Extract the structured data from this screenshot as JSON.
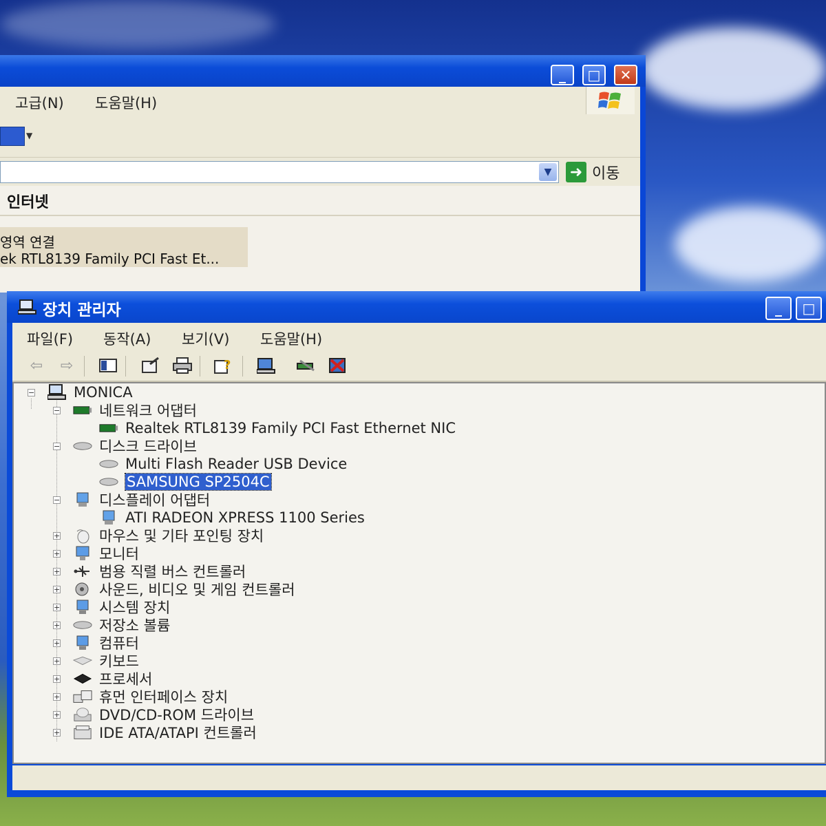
{
  "background_window": {
    "menu": [
      "고급(N)",
      "도움말(H)"
    ],
    "go_label": "이동",
    "heading": "인터넷",
    "selected_item_line1": "영역 연결",
    "selected_item_line2": "ek RTL8139 Family PCI Fast Et..."
  },
  "device_manager": {
    "title": "장치 관리자",
    "menu": [
      "파일(F)",
      "동작(A)",
      "보기(V)",
      "도움말(H)"
    ],
    "toolbar_icons": [
      "back-icon",
      "forward-icon",
      "show-hide-console-tree-icon",
      "properties-icon",
      "print-icon",
      "help-icon",
      "scan-hardware-icon",
      "update-driver-icon",
      "uninstall-icon"
    ],
    "tree": {
      "root": "MONICA",
      "network_adapters": "네트워크 어댑터",
      "network_child": "Realtek RTL8139 Family PCI Fast Ethernet NIC",
      "disk_drives": "디스크 드라이브",
      "disk_child_1": "Multi Flash Reader USB Device",
      "disk_child_2": "SAMSUNG SP2504C",
      "display_adapters": "디스플레이 어댑터",
      "display_child": "ATI RADEON XPRESS 1100 Series",
      "collapsed": [
        "마우스 및 기타 포인팅 장치",
        "모니터",
        "범용 직렬 버스 컨트롤러",
        "사운드, 비디오 및 게임 컨트롤러",
        "시스템 장치",
        "저장소 볼륨",
        "컴퓨터",
        "키보드",
        "프로세서",
        "휴먼 인터페이스 장치",
        "DVD/CD-ROM 드라이브",
        "IDE ATA/ATAPI 컨트롤러"
      ]
    }
  }
}
